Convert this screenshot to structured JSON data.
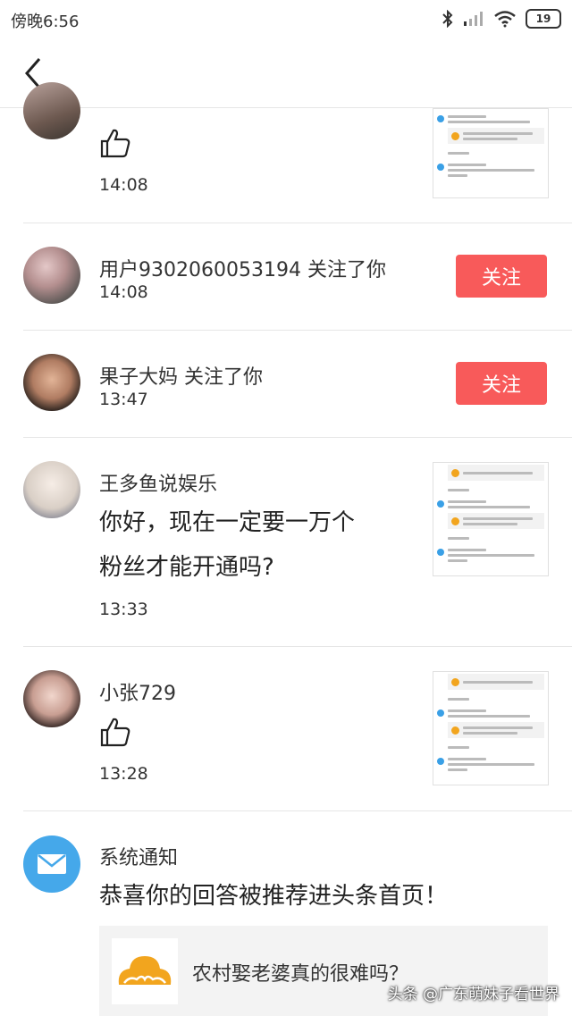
{
  "status": {
    "time": "傍晚6:56",
    "battery": "19"
  },
  "items": [
    {
      "time": "14:08"
    },
    {
      "name_text": "用户9302060053194 关注了你",
      "time": "14:08",
      "follow_label": "关注"
    },
    {
      "name_text": "果子大妈 关注了你",
      "time": "13:47",
      "follow_label": "关注"
    },
    {
      "name": "王多鱼说娱乐",
      "message_line1": "你好，现在一定要一万个",
      "message_line2": "粉丝才能开通吗?",
      "time": "13:33"
    },
    {
      "name": "小张729",
      "time": "13:28"
    },
    {
      "name": "系统通知",
      "message": "恭喜你的回答被推荐进头条首页！",
      "card_title": "农村娶老婆真的很难吗？"
    }
  ],
  "watermark": "头条 @广东萌妹子看世界",
  "colors": {
    "follow_button": "#f85a5a",
    "system_icon": "#45a8ea"
  }
}
